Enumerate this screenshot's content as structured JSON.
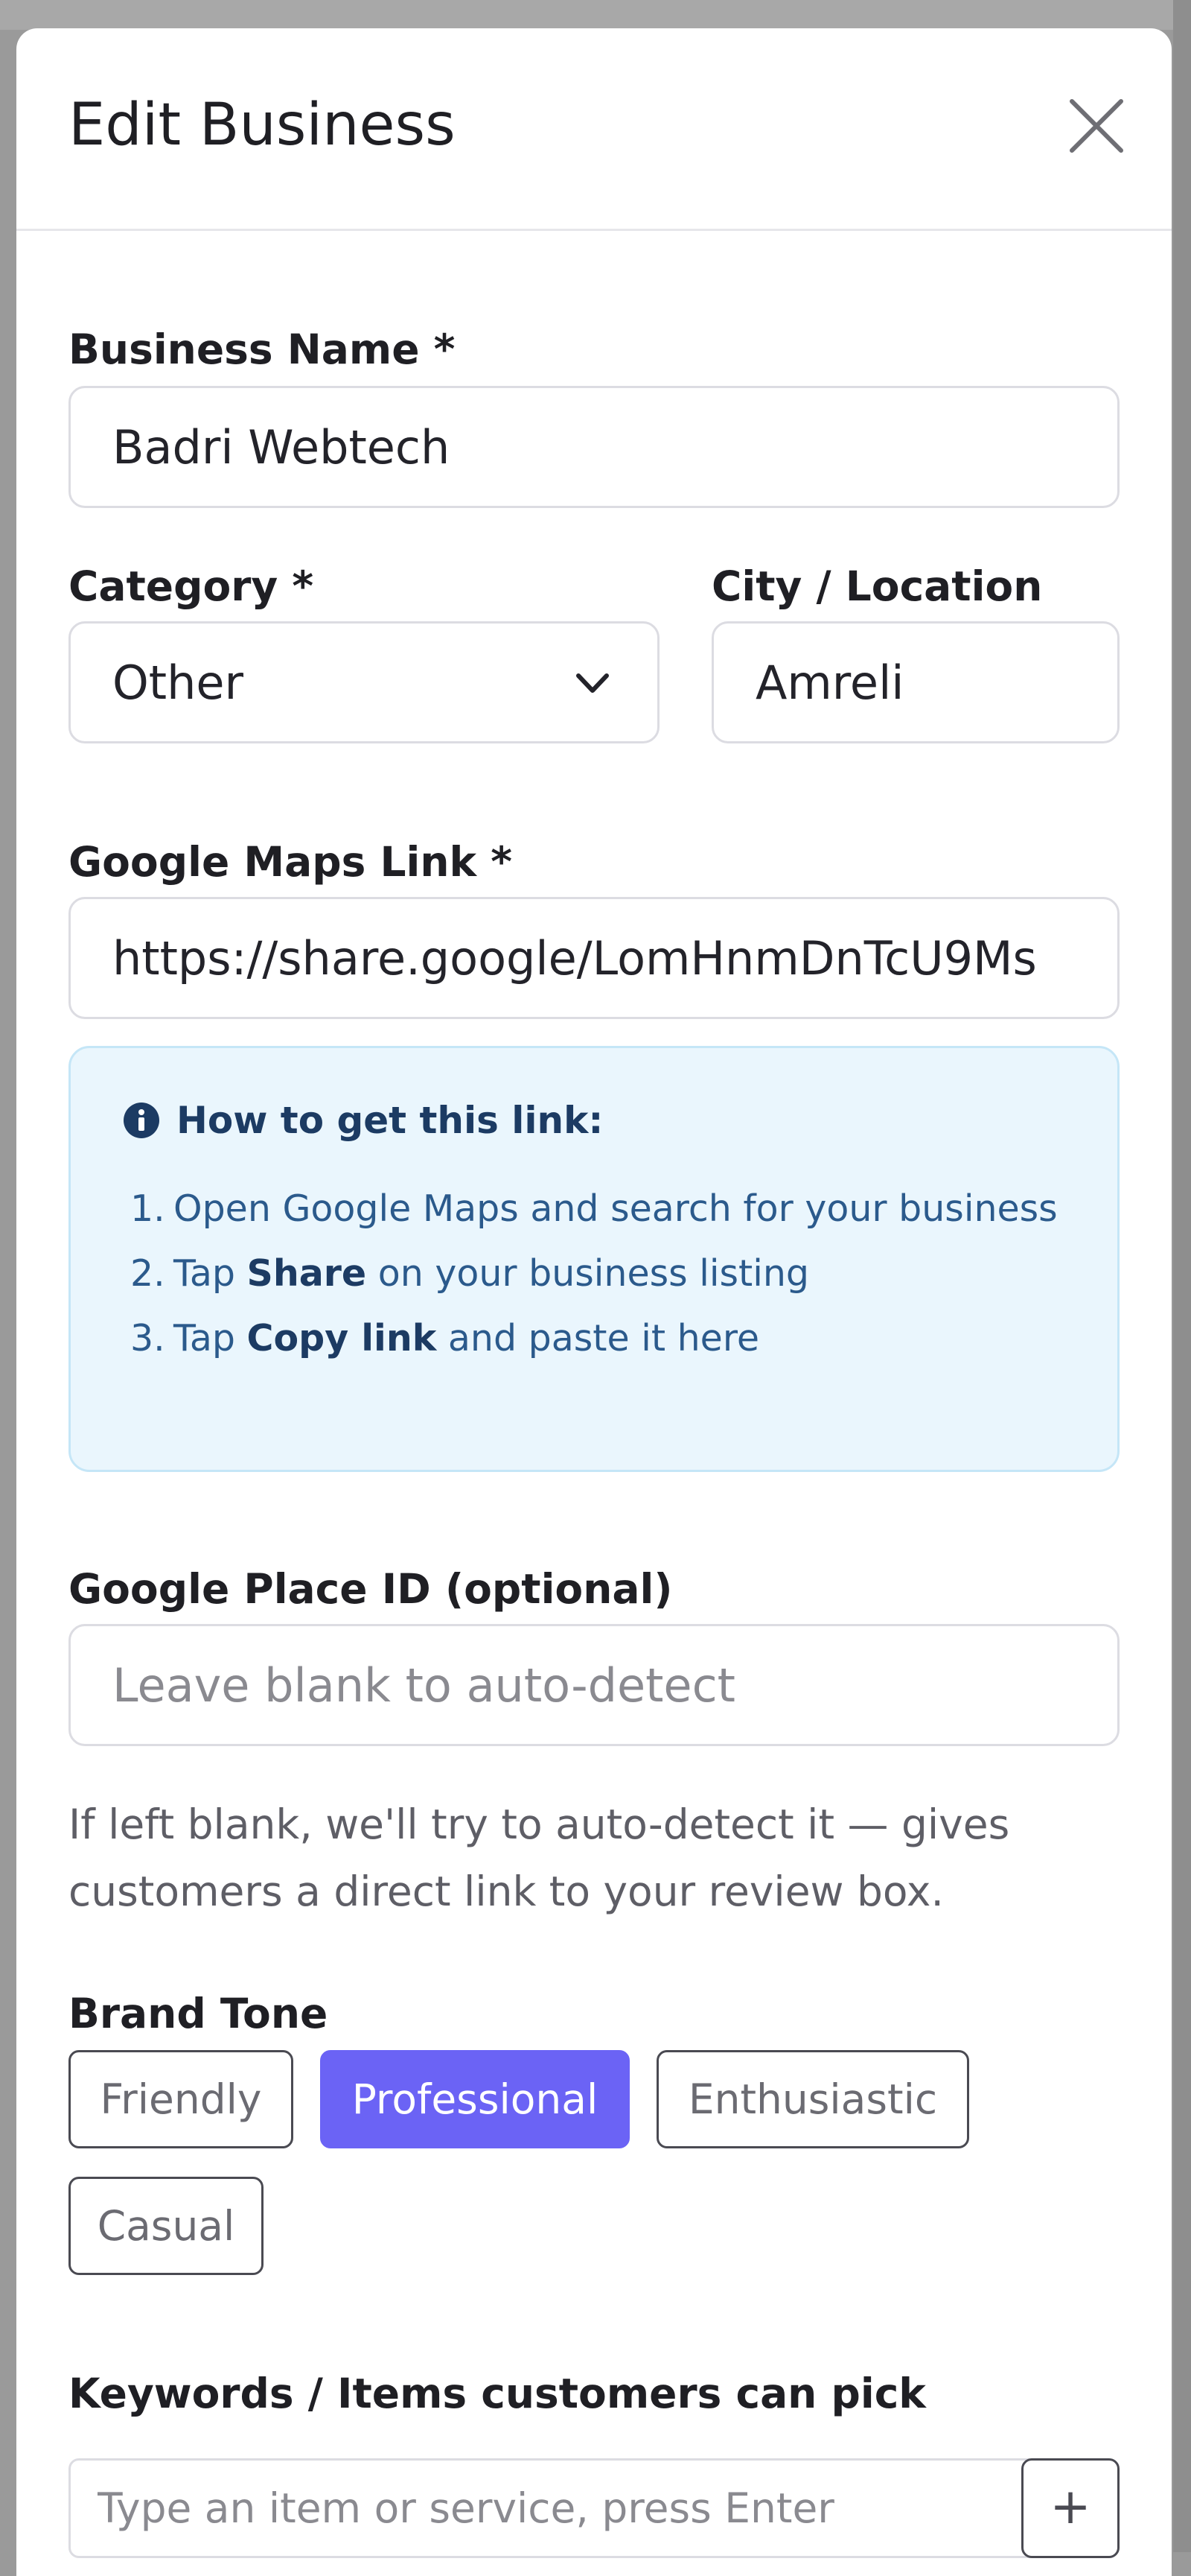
{
  "modal": {
    "title": "Edit Business"
  },
  "fields": {
    "business_name": {
      "label": "Business Name *",
      "value": "Badri Webtech"
    },
    "category": {
      "label": "Category *",
      "value": "Other"
    },
    "city": {
      "label": "City / Location",
      "value": "Amreli"
    },
    "maps_link": {
      "label": "Google Maps Link *",
      "value": "https://share.google/LomHnmDnTcU9Ms"
    },
    "place_id": {
      "label": "Google Place ID (optional)",
      "placeholder": "Leave blank to auto-detect",
      "help": "If left blank, we'll try to auto-detect it — gives customers a direct link to your review box."
    }
  },
  "info": {
    "title": "How to get this link:",
    "steps": [
      {
        "num": "1.",
        "pre": "Open Google Maps and search for your business",
        "bold": "",
        "post": ""
      },
      {
        "num": "2.",
        "pre": "Tap ",
        "bold": "Share",
        "post": " on your business listing"
      },
      {
        "num": "3.",
        "pre": "Tap ",
        "bold": "Copy link",
        "post": " and paste it here"
      }
    ]
  },
  "brand_tone": {
    "label": "Brand Tone",
    "options": [
      "Friendly",
      "Professional",
      "Enthusiastic",
      "Casual"
    ],
    "selected": "Professional"
  },
  "keywords": {
    "label": "Keywords / Items customers can pick",
    "placeholder": "Type an item or service, press Enter",
    "add_label": "+"
  },
  "colors": {
    "accent": "#6b63f5",
    "info_bg": "#eaf6fd",
    "info_text": "#2b5a8c"
  }
}
